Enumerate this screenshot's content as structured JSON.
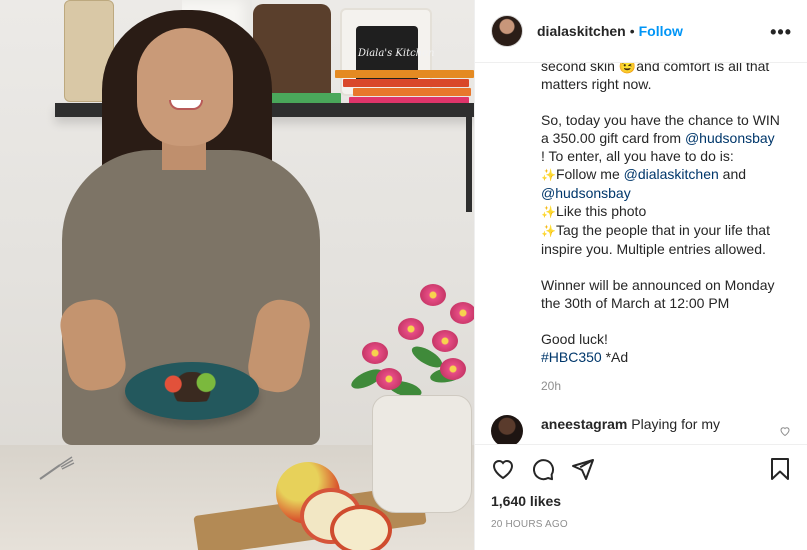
{
  "header": {
    "username": "dialaskitchen",
    "separator": "•",
    "follow_label": "Follow",
    "more_label": "•••"
  },
  "photo": {
    "slate_text": "Diala's Kitchen"
  },
  "caption": {
    "line1": "second skin 😉and comfort is all that",
    "line2": "matters right now.",
    "para2_part1": "So, today you have the chance to WIN a 350.00 gift card from ",
    "para2_mention": "@hudsonsbay",
    "para2_part2": "! To enter, all you have to do is:",
    "step1_text": "Follow me ",
    "step1_mention1": "@dialaskitchen",
    "step1_and": " and",
    "step1_mention2": "@hudsonsbay",
    "step2_text": "Like this photo",
    "step3_text": "Tag the people that in your life that inspire you. Multiple entries allowed.",
    "sparkle_icon": "✨",
    "winner_text": "Winner will be announced on Monday the 30th of March at 12:00 PM",
    "good_luck": "Good luck!",
    "hashtag": "#HBC350",
    "ad_text": " *Ad",
    "time_ago": "20h"
  },
  "comment": {
    "username": "aneestagram",
    "text": "Playing for my"
  },
  "actions": {
    "likes": "1,640 likes",
    "posted": "20 HOURS AGO"
  },
  "colors": {
    "link": "#0095f6",
    "mention": "#00376b",
    "muted": "#8e8e8e"
  }
}
